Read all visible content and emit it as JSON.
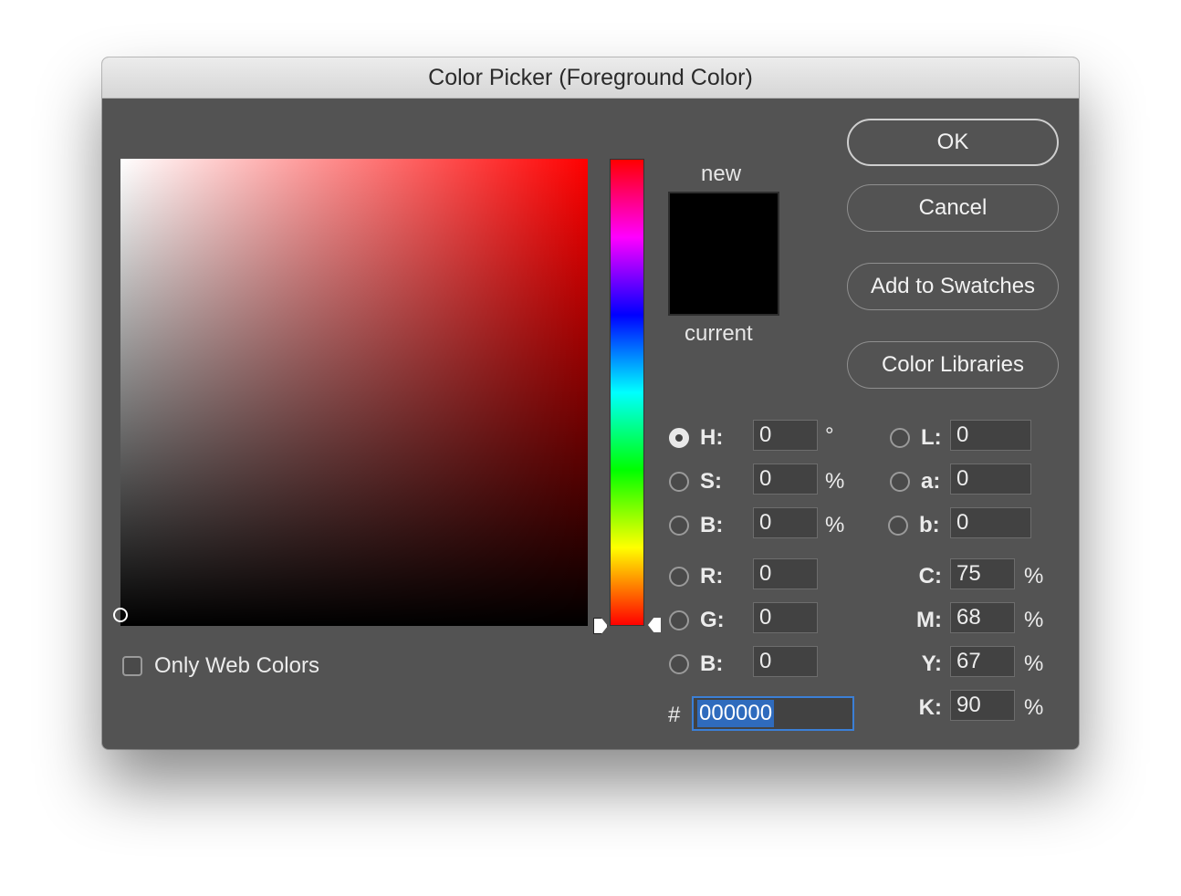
{
  "title": "Color Picker (Foreground Color)",
  "preview": {
    "new_label": "new",
    "current_label": "current",
    "new_color": "#000000",
    "current_color": "#000000"
  },
  "buttons": {
    "ok": "OK",
    "cancel": "Cancel",
    "add_to_swatches": "Add to Swatches",
    "color_libraries": "Color Libraries"
  },
  "only_web_colors": {
    "label": "Only Web Colors",
    "checked": false
  },
  "hsb": {
    "selected": "H",
    "h": {
      "label": "H:",
      "value": "0",
      "unit": "°"
    },
    "s": {
      "label": "S:",
      "value": "0",
      "unit": "%"
    },
    "b": {
      "label": "B:",
      "value": "0",
      "unit": "%"
    }
  },
  "rgb": {
    "r": {
      "label": "R:",
      "value": "0"
    },
    "g": {
      "label": "G:",
      "value": "0"
    },
    "b": {
      "label": "B:",
      "value": "0"
    }
  },
  "lab": {
    "l": {
      "label": "L:",
      "value": "0"
    },
    "a": {
      "label": "a:",
      "value": "0"
    },
    "b": {
      "label": "b:",
      "value": "0"
    }
  },
  "cmyk": {
    "c": {
      "label": "C:",
      "value": "75",
      "unit": "%"
    },
    "m": {
      "label": "M:",
      "value": "68",
      "unit": "%"
    },
    "y": {
      "label": "Y:",
      "value": "67",
      "unit": "%"
    },
    "k": {
      "label": "K:",
      "value": "90",
      "unit": "%"
    }
  },
  "hex": {
    "label": "#",
    "value": "000000"
  },
  "hue_color": "#ff0000",
  "accent_color": "#3b7fd6"
}
